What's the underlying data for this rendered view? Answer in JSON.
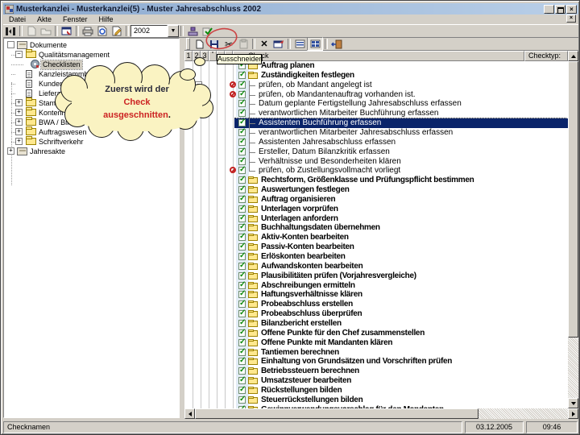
{
  "window": {
    "title": "Musterkanzlei - Musterkanzlei(5) - Muster Jahresabschluss 2002",
    "controls": [
      "minimize-button",
      "restore-button",
      "close-button"
    ]
  },
  "menu": {
    "items": [
      "Datei",
      "Akte",
      "Fenster",
      "Hilfe"
    ]
  },
  "main_toolbar": {
    "year_value": "2002",
    "buttons": [
      "panels-icon",
      "new-document-icon",
      "open-folder-icon",
      "client-window-icon",
      "print-icon",
      "print-preview-icon",
      "edit-document-icon",
      "year-select",
      "stamp-icon",
      "apply-check-icon"
    ]
  },
  "tree": {
    "items": [
      {
        "label": "Dokumente",
        "icon": "archive",
        "exp": "box",
        "level": 0,
        "selected": false
      },
      {
        "label": "Qualitätsmanagement",
        "icon": "folder",
        "exp": "minus",
        "level": 1,
        "selected": false
      },
      {
        "label": "Checklisten",
        "icon": "gear",
        "exp": "none",
        "level": 2,
        "selected": true
      },
      {
        "label": "Kanzleistammblatt",
        "icon": "doc",
        "exp": "none",
        "level": 1,
        "selected": false
      },
      {
        "label": "Kundenstamm",
        "icon": "doc",
        "exp": "none",
        "level": 1,
        "selected": false
      },
      {
        "label": "Lieferantenstamm",
        "icon": "doc",
        "exp": "none",
        "level": 1,
        "selected": false
      },
      {
        "label": "Stammdaten",
        "icon": "folder",
        "exp": "plus",
        "level": 1,
        "selected": false
      },
      {
        "label": "Kontenrahmen",
        "icon": "folder",
        "exp": "plus",
        "level": 1,
        "selected": false
      },
      {
        "label": "BWA / Bilanz",
        "icon": "folder",
        "exp": "plus",
        "level": 1,
        "selected": false
      },
      {
        "label": "Auftragswesen",
        "icon": "folder",
        "exp": "plus",
        "level": 1,
        "selected": false
      },
      {
        "label": "Schriftverkehr",
        "icon": "folder",
        "exp": "plus",
        "level": 1,
        "selected": false
      },
      {
        "label": "Jahresakte",
        "icon": "archive",
        "exp": "plus",
        "level": 0,
        "selected": false
      }
    ]
  },
  "list": {
    "toolbar_buttons": [
      "new-page-icon",
      "save-icon",
      "cut-icon",
      "paste-icon",
      "delete-x-icon",
      "window-export-icon",
      "view-list-icon",
      "view-details-icon",
      "exit-door-icon"
    ],
    "narrow_headers": [
      "1",
      "2",
      "3",
      "°",
      "",
      ""
    ],
    "check_header": "Check",
    "type_header": "Checktyp:",
    "rows": [
      {
        "text": "Auftrag planen",
        "kind": "group"
      },
      {
        "text": "Zuständigkeiten festlegen",
        "kind": "group"
      },
      {
        "text": "prüfen, ob Mandant angelegt ist",
        "kind": "child",
        "red": true
      },
      {
        "text": "prüfen, ob Mandantenauftrag vorhanden ist.",
        "kind": "child",
        "red": true
      },
      {
        "text": "Datum geplante Fertigstellung Jahresabschluss erfassen",
        "kind": "child"
      },
      {
        "text": "verantwortlichen Mitarbeiter Buchführung erfassen",
        "kind": "child",
        "marker": true
      },
      {
        "text": "Assistenten Buchführung erfassen",
        "kind": "child",
        "selected": true
      },
      {
        "text": "verantwortlichen Mitarbeiter Jahresabschluss erfassen",
        "kind": "child"
      },
      {
        "text": "Assistenten Jahresabschluss erfassen",
        "kind": "child"
      },
      {
        "text": "Ersteller, Datum Bilanzkritik erfassen",
        "kind": "child"
      },
      {
        "text": "Verhältnisse und Besonderheiten klären",
        "kind": "child"
      },
      {
        "text": "prüfen, ob Zustellungsvollmacht vorliegt",
        "kind": "child",
        "red": true,
        "last": true
      },
      {
        "text": "Rechtsform, Größenklasse und Prüfungspflicht bestimmen",
        "kind": "group"
      },
      {
        "text": "Auswertungen festlegen",
        "kind": "group"
      },
      {
        "text": "Auftrag organisieren",
        "kind": "group"
      },
      {
        "text": "Unterlagen vorprüfen",
        "kind": "group"
      },
      {
        "text": "Unterlagen anfordern",
        "kind": "group"
      },
      {
        "text": "Buchhaltungsdaten übernehmen",
        "kind": "group"
      },
      {
        "text": "Aktiv-Konten bearbeiten",
        "kind": "group"
      },
      {
        "text": "Passiv-Konten bearbeiten",
        "kind": "group"
      },
      {
        "text": "Erlöskonten bearbeiten",
        "kind": "group"
      },
      {
        "text": "Aufwandskonten bearbeiten",
        "kind": "group"
      },
      {
        "text": "Plausibilitäten prüfen (Vorjahresvergleiche)",
        "kind": "group"
      },
      {
        "text": "Abschreibungen ermitteln",
        "kind": "group"
      },
      {
        "text": "Haftungsverhältnisse klären",
        "kind": "group"
      },
      {
        "text": "Probeabschluss erstellen",
        "kind": "group"
      },
      {
        "text": "Probeabschluss überprüfen",
        "kind": "group"
      },
      {
        "text": "Bilanzbericht erstellen",
        "kind": "group"
      },
      {
        "text": "Offene Punkte für den Chef zusammenstellen",
        "kind": "group"
      },
      {
        "text": "Offene Punkte mit Mandanten klären",
        "kind": "group"
      },
      {
        "text": "Tantiemen berechnen",
        "kind": "group"
      },
      {
        "text": "Einhaltung von Grundsätzen und Vorschriften prüfen",
        "kind": "group"
      },
      {
        "text": "Betriebssteuern berechnen",
        "kind": "group"
      },
      {
        "text": "Umsatzsteuer bearbeiten",
        "kind": "group"
      },
      {
        "text": "Rückstellungen bilden",
        "kind": "group"
      },
      {
        "text": "Steuerrückstellungen bilden",
        "kind": "group"
      },
      {
        "text": "Gewinnverwendungsvorschlag für den Mandanten",
        "kind": "group"
      }
    ]
  },
  "annotation": {
    "line1": "Zuerst wird der",
    "line2": "Check",
    "line3": "ausgeschnitten",
    "period": ".",
    "line1_color": "#2a2a3a",
    "red_color": "#cc2222"
  },
  "tooltip": {
    "text": "Ausschneiden"
  },
  "status": {
    "left": "Checknamen",
    "date": "03.12.2005",
    "time": "09:46"
  },
  "colors": {
    "selection": "#0a246a",
    "titlebar_start": "#8ba9cf",
    "titlebar_end": "#b9cfe8",
    "cloud_fill": "#faf3c2",
    "annotation_red": "#cc4444",
    "check_green": "#0c8a0c",
    "folder_yellow": "#ffe88e"
  }
}
